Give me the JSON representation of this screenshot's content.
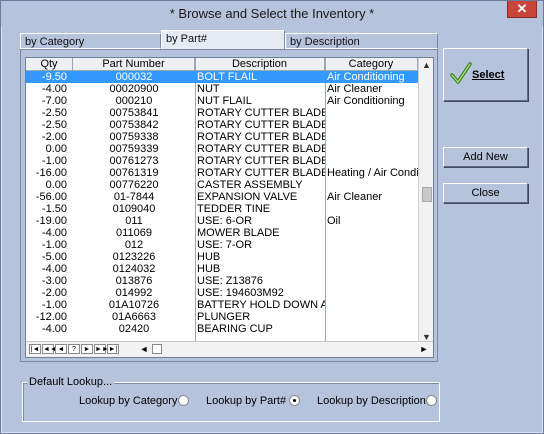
{
  "window": {
    "title": "* Browse and Select the Inventory *",
    "close_glyph": "✕"
  },
  "tabs": [
    "by Category",
    "by Part#",
    "by Description"
  ],
  "grid": {
    "columns": [
      "Qty",
      "Part Number",
      "Description",
      "Category"
    ],
    "rows": [
      [
        "-9.50",
        "000032",
        "BOLT FLAIL",
        "Air Conditioning"
      ],
      [
        "-4.00",
        "00020900",
        "NUT",
        "Air Cleaner"
      ],
      [
        "-7.00",
        "000210",
        "NUT FLAIL",
        "Air Conditioning"
      ],
      [
        "-2.50",
        "00753841",
        "ROTARY CUTTER BLADE",
        ""
      ],
      [
        "-2.50",
        "00753842",
        "ROTARY CUTTER BLADE",
        ""
      ],
      [
        "-2.00",
        "00759338",
        "ROTARY CUTTER BLADE",
        ""
      ],
      [
        "0.00",
        "00759339",
        "ROTARY CUTTER BLADE",
        ""
      ],
      [
        "-1.00",
        "00761273",
        "ROTARY CUTTER BLADE",
        ""
      ],
      [
        "-16.00",
        "00761319",
        "ROTARY CUTTER BLADE",
        "Heating / Air Conditio"
      ],
      [
        "0.00",
        "00776220",
        "CASTER ASSEMBLY",
        ""
      ],
      [
        "-56.00",
        "01-7844",
        "EXPANSION VALVE",
        "Air Cleaner"
      ],
      [
        "-1.50",
        "0109040",
        "TEDDER TINE",
        ""
      ],
      [
        "-19.00",
        "011",
        "USE: 6-OR",
        "Oil"
      ],
      [
        "-4.00",
        "011069",
        "MOWER BLADE",
        ""
      ],
      [
        "-1.00",
        "012",
        "USE: 7-OR",
        ""
      ],
      [
        "-5.00",
        "0123226",
        "HUB",
        ""
      ],
      [
        "-4.00",
        "0124032",
        "HUB",
        ""
      ],
      [
        "-3.00",
        "013876",
        "USE: Z13876",
        ""
      ],
      [
        "-2.00",
        "014992",
        "USE: 194603M92",
        ""
      ],
      [
        "-1.00",
        "01A10726",
        "BATTERY HOLD DOWN ASY",
        ""
      ],
      [
        "-12.00",
        "01A6663",
        "PLUNGER",
        ""
      ],
      [
        "-4.00",
        "02420",
        "BEARING CUP",
        ""
      ]
    ],
    "selected_row": 0,
    "nav_buttons": [
      "|◄",
      "◄◄",
      "◄",
      "?",
      "►",
      "►►",
      "►|"
    ]
  },
  "buttons": {
    "select": "Select",
    "add_new": "Add New",
    "close": "Close"
  },
  "lookup": {
    "legend": "Default Lookup...",
    "options": [
      "Lookup by Category",
      "Lookup by Part#",
      "Lookup by Description"
    ],
    "selected": "Lookup by Part#"
  },
  "colors": {
    "window_bg": "#b5c3dc",
    "selection": "#3399ff",
    "close_button": "#c8453a"
  },
  "icons": [
    "check-icon",
    "close-icon"
  ]
}
